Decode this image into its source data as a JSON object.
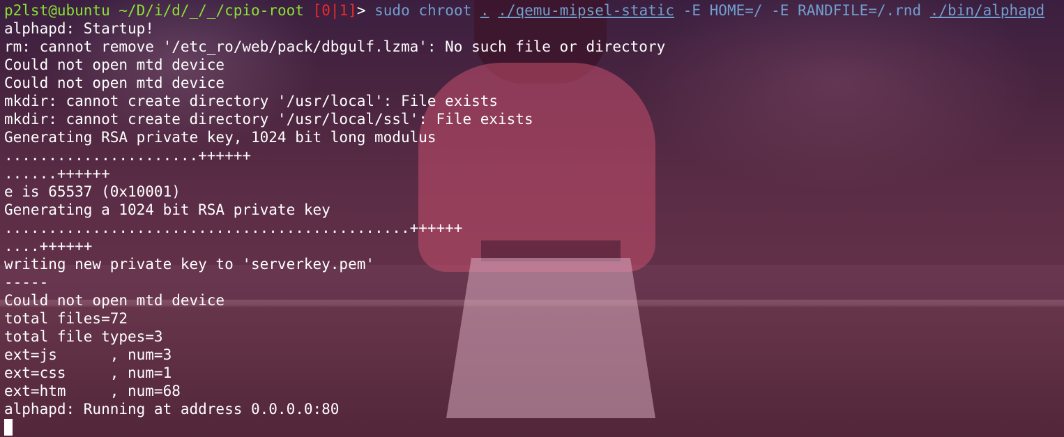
{
  "prompt": {
    "user_host": "p2lst@ubuntu",
    "path": "~/D/i/d/_/_/cpio-root",
    "bracket_open": "[",
    "jobs_a": "0",
    "jobs_sep": "|",
    "jobs_b": "1",
    "bracket_close": "]",
    "symbol": ">",
    "command": "sudo",
    "arg_chroot": "chroot",
    "arg_dot": ".",
    "arg_qemu": "./qemu-mipsel-static",
    "arg_env": "-E HOME=/ -E RANDFILE=/.rnd",
    "arg_bin": "./bin/alphapd"
  },
  "output": [
    "alphapd: Startup!",
    "rm: cannot remove '/etc_ro/web/pack/dbgulf.lzma': No such file or directory",
    "Could not open mtd device",
    "Could not open mtd device",
    "mkdir: cannot create directory '/usr/local': File exists",
    "mkdir: cannot create directory '/usr/local/ssl': File exists",
    "Generating RSA private key, 1024 bit long modulus",
    "......................++++++",
    "......++++++",
    "e is 65537 (0x10001)",
    "Generating a 1024 bit RSA private key",
    "..............................................++++++",
    "....++++++",
    "writing new private key to 'serverkey.pem'",
    "-----",
    "Could not open mtd device",
    "total files=72",
    "total file types=3",
    "ext=js      , num=3",
    "ext=css     , num=1",
    "ext=htm     , num=68",
    "alphapd: Running at address 0.0.0.0:80"
  ],
  "colors": {
    "prompt_user": "#8ae234",
    "command": "#729fcf",
    "jobs": "#ef2929",
    "text": "#ffffff"
  }
}
